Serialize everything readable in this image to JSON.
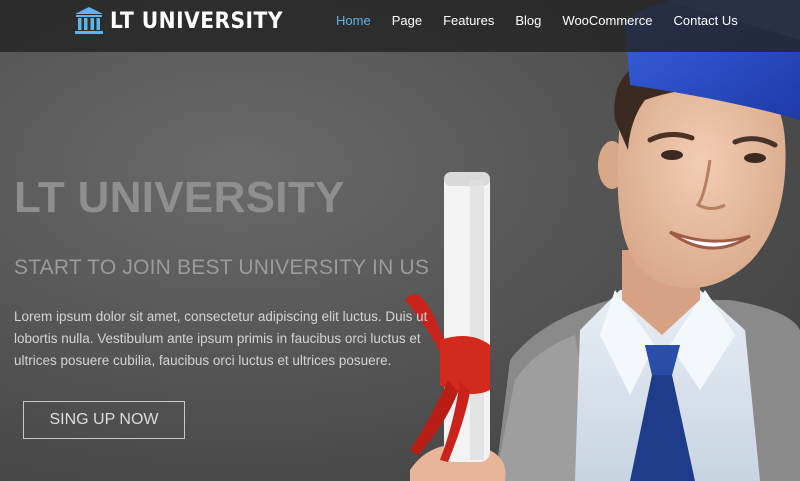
{
  "brand": {
    "name": "LT UNIVERSITY",
    "icon": "university-building-icon",
    "accent": "#5fb4e8"
  },
  "nav": {
    "items": [
      {
        "label": "Home",
        "active": true
      },
      {
        "label": "Page",
        "active": false
      },
      {
        "label": "Features",
        "active": false
      },
      {
        "label": "Blog",
        "active": false
      },
      {
        "label": "WooCommerce",
        "active": false
      },
      {
        "label": "Contact Us",
        "active": false
      }
    ]
  },
  "hero": {
    "title": "LT UNIVERSITY",
    "subtitle": "START TO JOIN BEST UNIVERSITY IN US",
    "body": "Lorem ipsum dolor sit amet, consectetur adipiscing elit luctus. Duis ut lobortis nulla. Vestibulum ante ipsum primis in faucibus orci luctus et ultrices posuere cubilia, faucibus orci luctus et ultrices posuere.",
    "cta_label": "SING UP NOW"
  },
  "colors": {
    "navbar_bg": "#232323",
    "title": "#8f8f8f",
    "graduation_cap": "#2b4fc7",
    "diploma_ribbon": "#d42a1e",
    "tie": "#1f3c8a"
  }
}
